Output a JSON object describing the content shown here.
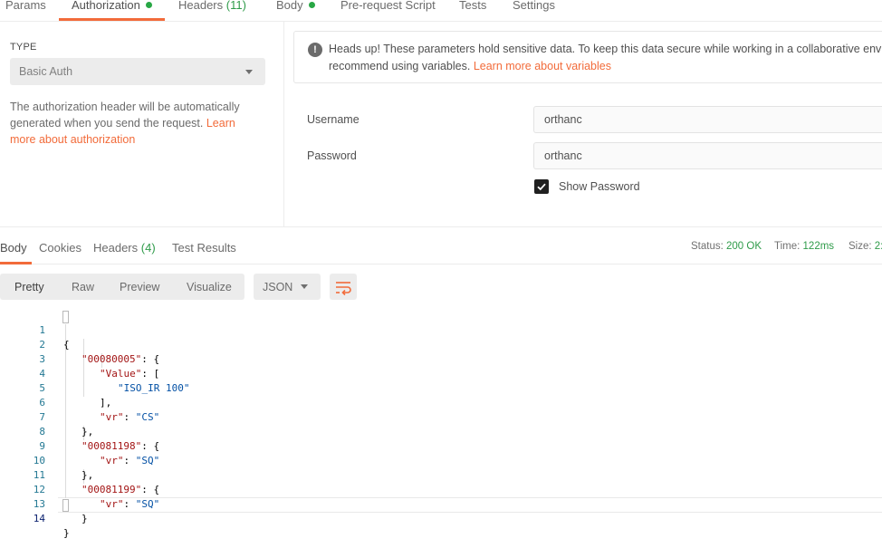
{
  "request_tabs": [
    {
      "label": "Params"
    },
    {
      "label": "Authorization"
    },
    {
      "label": "Headers",
      "count": "(11)"
    },
    {
      "label": "Body"
    },
    {
      "label": "Pre-request Script"
    },
    {
      "label": "Tests"
    },
    {
      "label": "Settings"
    }
  ],
  "auth": {
    "type_label": "TYPE",
    "type_value": "Basic Auth",
    "description": "The authorization header will be automatically generated when you send the request.",
    "learn_more": "Learn more about authorization",
    "warning": {
      "line1": "Heads up! These parameters hold sensitive data. To keep this data secure while working in a collaborative env",
      "line2": "recommend using variables.",
      "link": "Learn more about variables"
    },
    "username_label": "Username",
    "username_value": "orthanc",
    "password_label": "Password",
    "password_value": "orthanc",
    "show_password_label": "Show Password",
    "show_password_checked": true
  },
  "response_tabs": [
    {
      "label": "Body"
    },
    {
      "label": "Cookies"
    },
    {
      "label": "Headers",
      "count": "(4)"
    },
    {
      "label": "Test Results"
    }
  ],
  "status": {
    "status_label": "Status:",
    "status_value": "200 OK",
    "time_label": "Time:",
    "time_value": "122ms",
    "size_label": "Size:",
    "size_value": "2:"
  },
  "view_modes": [
    "Pretty",
    "Raw",
    "Preview",
    "Visualize"
  ],
  "format": "JSON",
  "code_lines": [
    {
      "n": "1",
      "text": "{"
    },
    {
      "n": "2",
      "text": "\"00080005\": {"
    },
    {
      "n": "3",
      "text": "\"Value\": ["
    },
    {
      "n": "4",
      "text": "\"ISO_IR 100\""
    },
    {
      "n": "5",
      "text": "],"
    },
    {
      "n": "6",
      "text": "\"vr\": \"CS\""
    },
    {
      "n": "7",
      "text": "},"
    },
    {
      "n": "8",
      "text": "\"00081198\": {"
    },
    {
      "n": "9",
      "text": "\"vr\": \"SQ\""
    },
    {
      "n": "10",
      "text": "},"
    },
    {
      "n": "11",
      "text": "\"00081199\": {"
    },
    {
      "n": "12",
      "text": "\"vr\": \"SQ\""
    },
    {
      "n": "13",
      "text": "}"
    },
    {
      "n": "14",
      "text": "}"
    }
  ],
  "colors": {
    "accent": "#f26b3a",
    "success": "#2f9b4a",
    "line_number": "#237893",
    "json_key": "#a31515",
    "json_string": "#0451a5"
  }
}
